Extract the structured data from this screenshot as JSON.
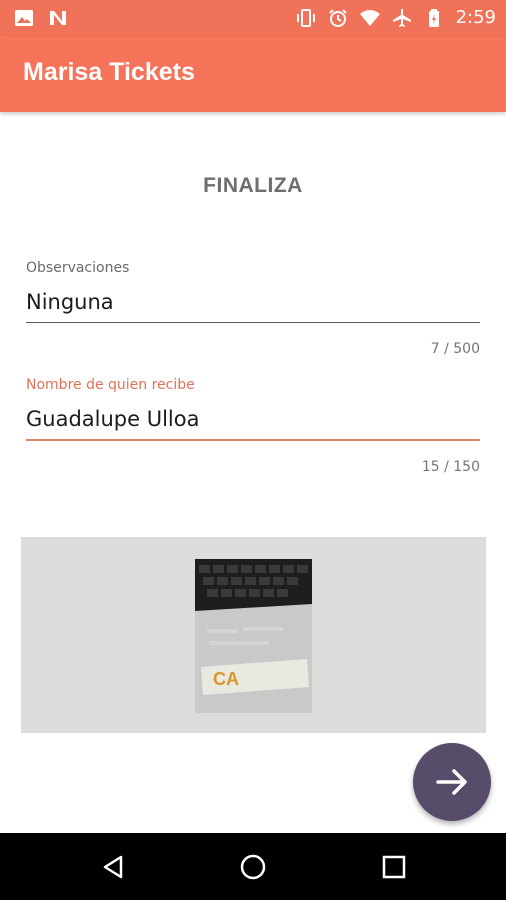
{
  "status_bar": {
    "time": "2:59",
    "left_icons": [
      "image-icon",
      "n-icon"
    ],
    "right_icons": [
      "vibrate-icon",
      "alarm-icon",
      "wifi-icon",
      "airplane-icon",
      "battery-icon"
    ]
  },
  "app_bar": {
    "title": "Marisa Tickets",
    "color": "#f47359"
  },
  "main": {
    "heading": "FINALIZA",
    "observations": {
      "label": "Observaciones",
      "value": "Ninguna",
      "counter": "7 / 500"
    },
    "recipient": {
      "label": "Nombre de quien recibe",
      "value": "Guadalupe Ulloa",
      "counter": "15 / 150"
    },
    "photo": {
      "logo_text": "CA"
    },
    "fab": {
      "icon": "arrow-right-icon",
      "color": "#574d6b"
    }
  },
  "nav_bar": {
    "buttons": [
      "back-icon",
      "home-icon",
      "recents-icon"
    ]
  },
  "colors": {
    "accent": "#e07257",
    "heading": "#6e6e6e"
  }
}
